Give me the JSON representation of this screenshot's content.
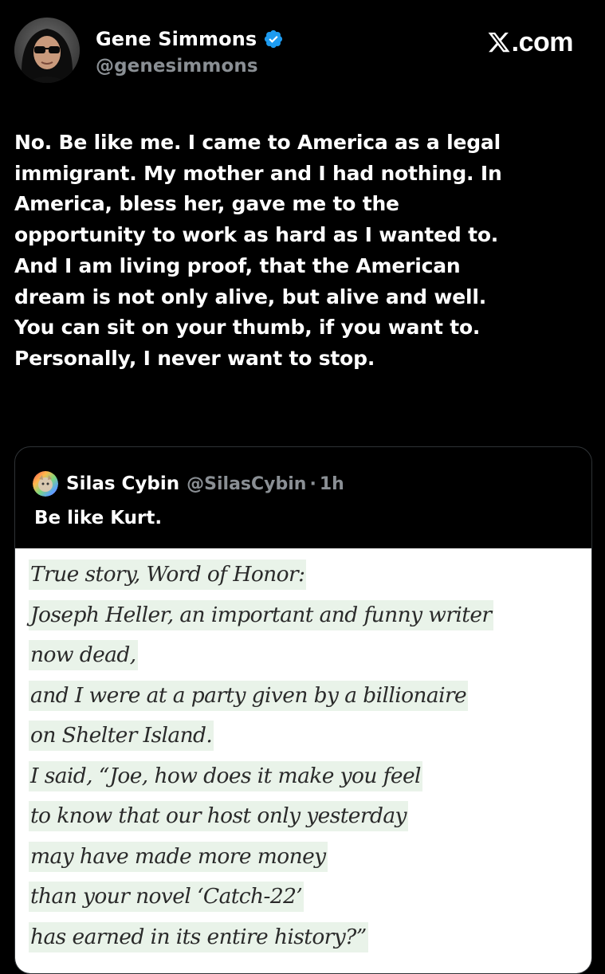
{
  "post": {
    "author_name": "Gene Simmons",
    "author_handle": "@genesimmons",
    "verified": true,
    "site_label": ".com",
    "text": "No. Be like me. I came to America as a legal\nimmigrant. My mother and I had nothing. In\nAmerica, bless her, gave me to the\nopportunity to work as hard as I wanted to.\nAnd I am living proof, that the American\ndream is not only alive, but alive and well.\nYou can sit on your thumb, if you want to.\nPersonally, I never want to stop."
  },
  "quote": {
    "author_name": "Silas Cybin",
    "author_handle": "@SilasCybin",
    "separator": "·",
    "time": "1h",
    "text": "Be like Kurt.",
    "excerpt_lines": [
      "True story, Word of Honor:",
      "Joseph Heller, an important and funny writer",
      "now dead,",
      "and I were at a party given by a billionaire",
      "on Shelter Island.",
      "I said, “Joe, how does it make you feel",
      "to know that our host only yesterday",
      "may have made more money",
      "than your novel ‘Catch-22’",
      "has earned in its entire history?”"
    ]
  },
  "colors": {
    "background": "#000000",
    "text_primary": "#ffffff",
    "text_secondary": "#8a8f94",
    "verified_blue": "#1d9bf0",
    "card_border": "#2f3336",
    "highlight": "#e9f3e9"
  },
  "icons": {
    "verified": "verified-badge-icon",
    "x_logo": "x-logo-icon"
  }
}
